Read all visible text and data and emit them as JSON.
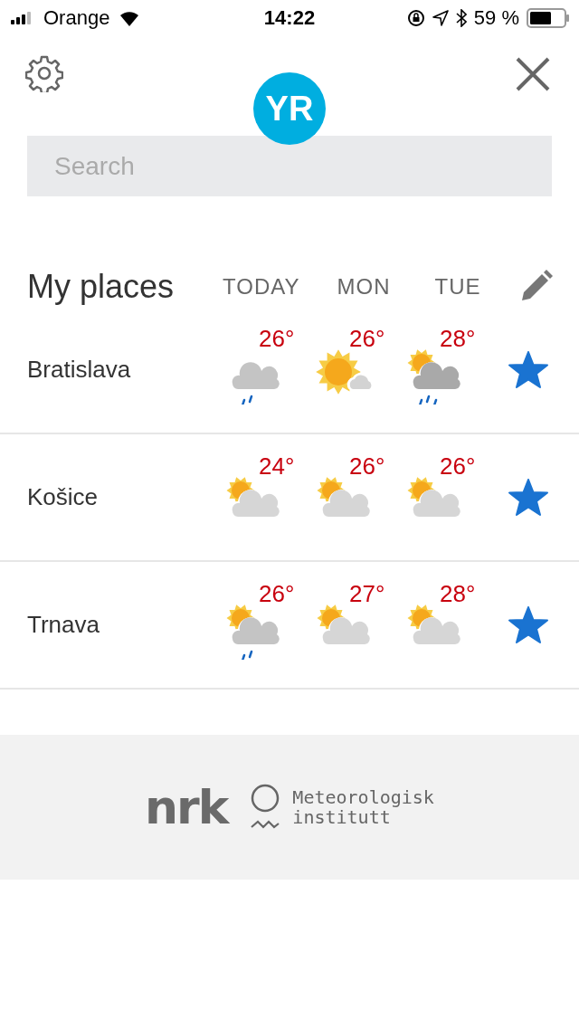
{
  "status_bar": {
    "carrier": "Orange",
    "time": "14:22",
    "battery": "59 %"
  },
  "header": {
    "logo": "YR"
  },
  "search": {
    "placeholder": "Search"
  },
  "places_header": {
    "title": "My places",
    "days": [
      "TODAY",
      "MON",
      "TUE"
    ]
  },
  "places": [
    {
      "name": "Bratislava",
      "favorite": true,
      "forecast": [
        {
          "temp": "26°",
          "kind": "cloud_rain"
        },
        {
          "temp": "26°",
          "kind": "sun_small_cloud"
        },
        {
          "temp": "28°",
          "kind": "sun_cloud_rain"
        }
      ]
    },
    {
      "name": "Košice",
      "favorite": true,
      "forecast": [
        {
          "temp": "24°",
          "kind": "sun_cloud"
        },
        {
          "temp": "26°",
          "kind": "sun_cloud"
        },
        {
          "temp": "26°",
          "kind": "sun_cloud"
        }
      ]
    },
    {
      "name": "Trnava",
      "favorite": true,
      "forecast": [
        {
          "temp": "26°",
          "kind": "sun_cloud_rain2"
        },
        {
          "temp": "27°",
          "kind": "sun_cloud"
        },
        {
          "temp": "28°",
          "kind": "sun_cloud"
        }
      ]
    }
  ],
  "footer": {
    "logo_nrk": "nrk",
    "met_line1": "Meteorologisk",
    "met_line2": "institutt"
  }
}
